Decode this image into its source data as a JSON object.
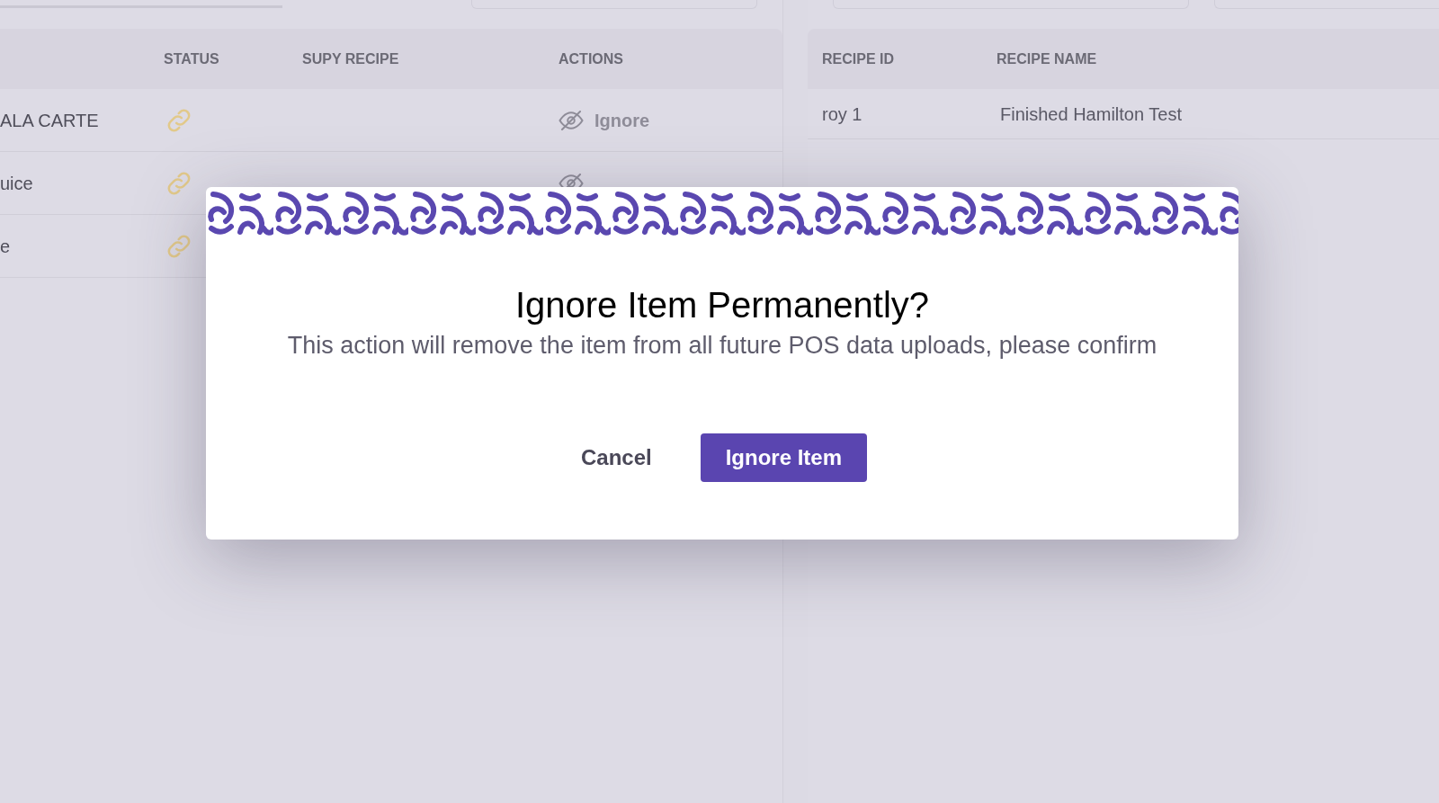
{
  "left_table": {
    "columns": [
      "STATUS",
      "SUPY RECIPE",
      "ACTIONS"
    ],
    "rows": [
      {
        "name": "ALA CARTE",
        "kind": "ignorable",
        "action": "Ignore"
      },
      {
        "name": "uice",
        "kind": "ignorable"
      },
      {
        "name": "e",
        "kind": "plain"
      }
    ]
  },
  "right_table": {
    "columns": [
      "RECIPE ID",
      "RECIPE NAME"
    ],
    "rows": [
      {
        "recipe_id": "roy 1",
        "recipe_name": "Finished Hamilton Test"
      }
    ]
  },
  "dialog": {
    "title": "Ignore Item Permanently?",
    "message": "This action will remove the item from all future POS data uploads, please confirm",
    "buttons": [
      {
        "label": "Cancel",
        "kind": "secondary"
      },
      {
        "label": "Ignore Item",
        "kind": "primary"
      }
    ]
  }
}
